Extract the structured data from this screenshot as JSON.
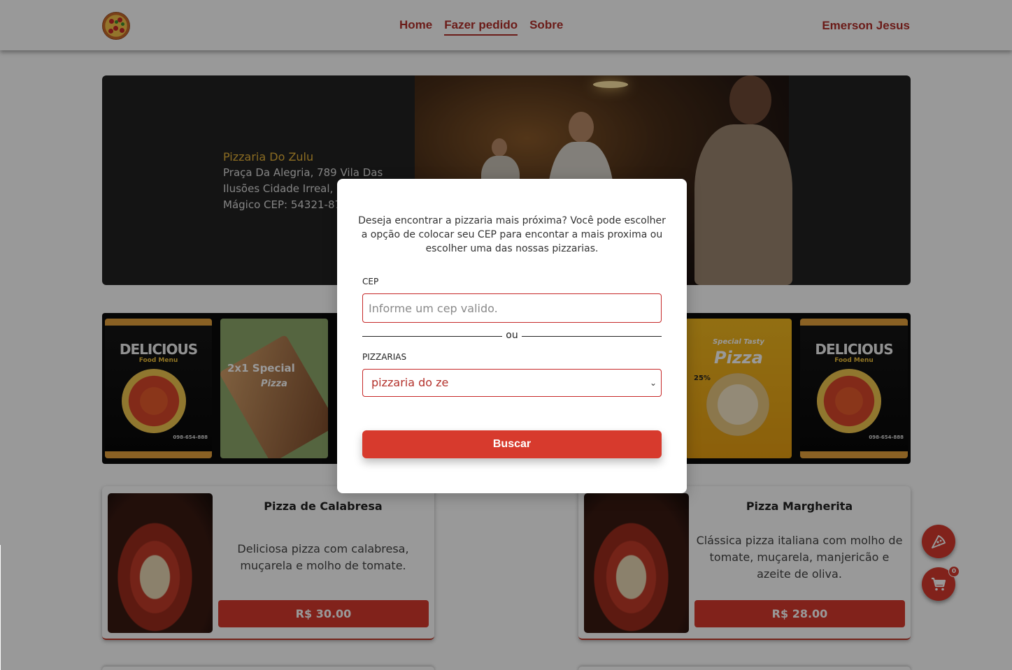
{
  "header": {
    "nav": {
      "home": "Home",
      "order": "Fazer pedido",
      "about": "Sobre"
    },
    "user_name": "Emerson Jesus"
  },
  "hero": {
    "name": "Pizzaria Do Zulu",
    "address": "Praça Da Alegria, 789 Vila Das Ilusões Cidade Irreal, Estado Mágico CEP: 54321-876"
  },
  "carousel": {
    "cards": [
      {
        "title": "DELICIOUS",
        "subtitle": "Food Menu",
        "phone": "098-654-888"
      },
      {
        "title": "2x1 Special",
        "subtitle": "Pizza"
      },
      {
        "title": "Special Tasty",
        "subtitle": "Pizza",
        "discount": "25%"
      },
      {
        "title": "DELICIOUS",
        "subtitle": "Food Menu",
        "phone": "098-654-888"
      }
    ]
  },
  "products": [
    {
      "title": "Pizza de Calabresa",
      "description": "Deliciosa pizza com calabresa, muçarela e molho de tomate.",
      "price": "R$ 30.00"
    },
    {
      "title": "Pizza Margherita",
      "description": "Clássica pizza italiana com molho de tomate, muçarela, manjericão e azeite de oliva.",
      "price": "R$ 28.00"
    }
  ],
  "cart": {
    "count": "0"
  },
  "modal": {
    "message": "Deseja encontrar a pizzaria mais próxima? Você pode escolher a opção de colocar seu CEP para encontar a mais proxima ou escolher uma das nossas pizzarias.",
    "cep_label": "CEP",
    "cep_placeholder": "Informe um cep valido.",
    "cep_value": "",
    "or_label": "ou",
    "pizzarias_label": "PIZZARIAS",
    "pizzarias_selected": "pizzaria do ze",
    "search_button": "Buscar"
  },
  "colors": {
    "accent": "#d73a2d",
    "brand_text": "#b3302a",
    "hero_name": "#e8b43a"
  }
}
